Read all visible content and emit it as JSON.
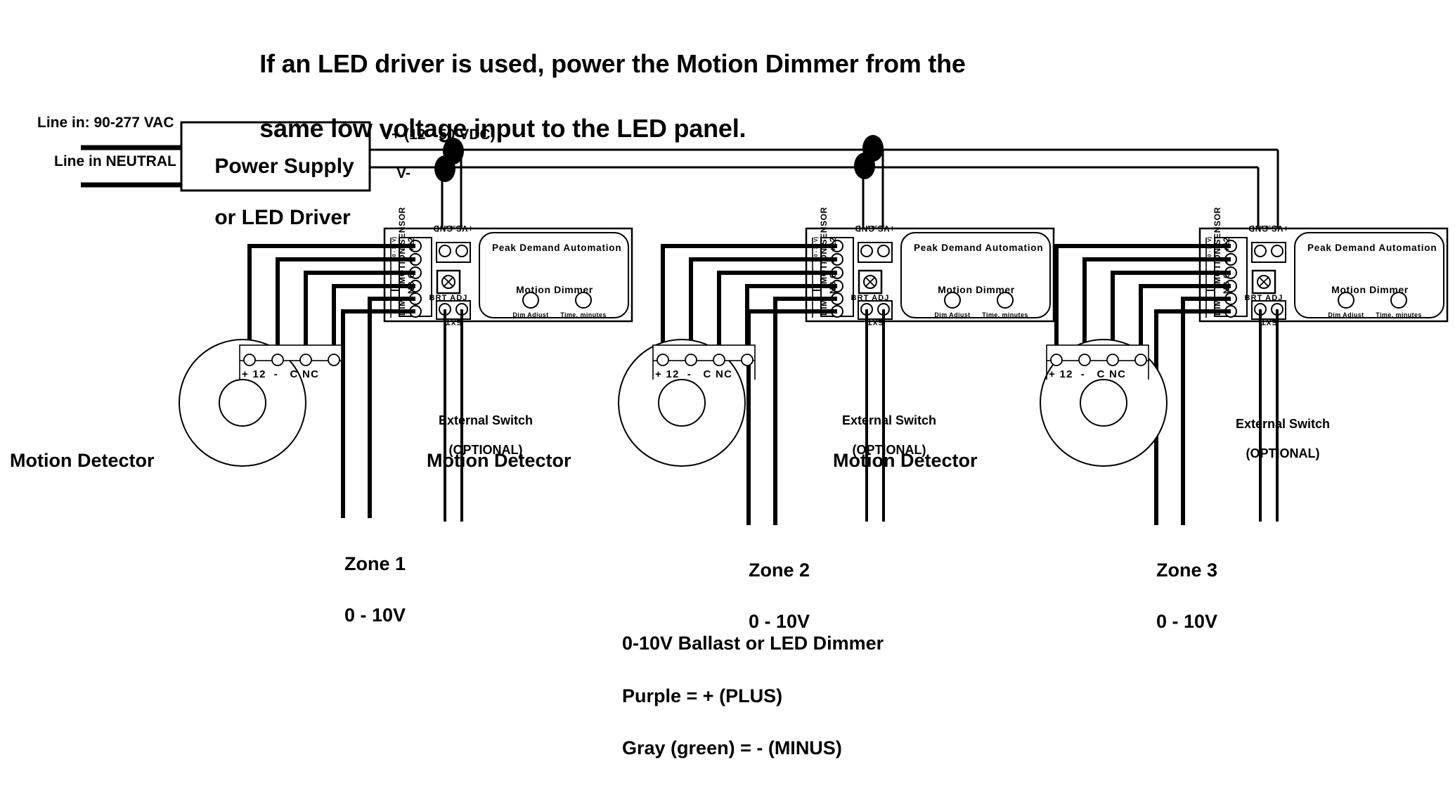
{
  "title": {
    "line1": "If an LED driver is used, power the Motion Dimmer from the",
    "line2": "same low voltage input to the LED panel."
  },
  "power_supply": {
    "line_in_label": "Line in: 90-277 VAC",
    "neutral_label": "Line in NEUTRAL",
    "box_line1": "Power Supply",
    "box_line2": "or LED Driver",
    "vplus_label": "V+ (12 - 50 VDC)",
    "vminus_label": "V-"
  },
  "module": {
    "brand": "Peak Demand Automation",
    "model": "Motion Dimmer",
    "knob_left": "Dim Adjust",
    "knob_right": "Time, minutes",
    "brt_adj": "BRT ADJ",
    "ext_sw": "EXT",
    "ext_sw_minus": "-",
    "ext_sw_plus": "+",
    "vs_gnd": "+VS GND",
    "vs_range": "12-50 V",
    "sensor_block": "MOTION SENSOR",
    "sensor_range": "(10 - 30 V)",
    "dim_block": "DIM",
    "terminals": [
      "+12",
      "-",
      "C",
      "NC",
      "+",
      "-"
    ]
  },
  "detector": {
    "name": "Motion Detector",
    "terminals": "+ 12  -   C NC"
  },
  "external_switch": {
    "line1": "External Switch",
    "line2": "(OPTIONAL)"
  },
  "zones": [
    {
      "name": "Zone 1",
      "voltage": "0 - 10V"
    },
    {
      "name": "Zone 2",
      "voltage": "0 - 10V"
    },
    {
      "name": "Zone 3",
      "voltage": "0 - 10V"
    }
  ],
  "footer": {
    "line1": "0-10V Ballast or LED Dimmer",
    "line2": "Purple = + (PLUS)",
    "line3": "Gray (green) = - (MINUS)"
  },
  "colors": {
    "ink": "#000000",
    "paper": "#ffffff"
  }
}
